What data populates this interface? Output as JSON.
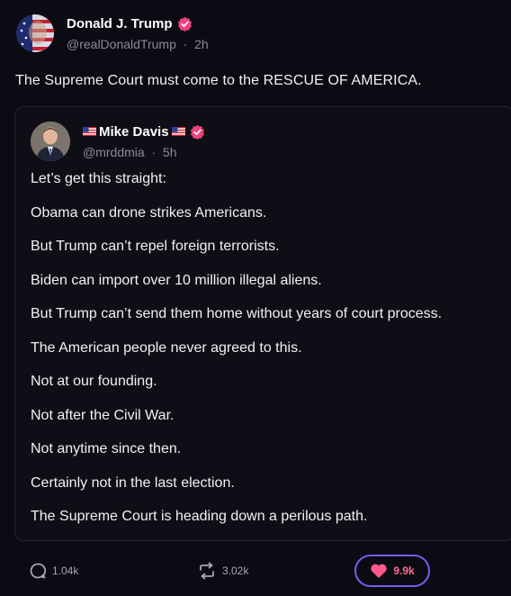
{
  "author": {
    "display_name": "Donald J. Trump",
    "handle": "@realDonaldTrump",
    "separator": "·",
    "time": "2h",
    "verified": true
  },
  "post": {
    "text": "The Supreme Court must come to the RESCUE OF AMERICA."
  },
  "quoted": {
    "author": {
      "display_name": "Mike Davis",
      "handle": "@mrddmia",
      "separator": "·",
      "time": "5h",
      "verified": true
    },
    "lines": [
      "Let’s get this straight:",
      "Obama can drone strikes Americans.",
      "But Trump can’t repel foreign terrorists.",
      "Biden can import over 10 million illegal aliens.",
      "But Trump can’t send them home without years of court process.",
      "The American people never agreed to this.",
      "Not at our founding.",
      "Not after the Civil War.",
      "Not anytime since then.",
      "Certainly not in the last election.",
      "The Supreme Court is heading down a perilous path."
    ]
  },
  "actions": {
    "replies": "1.04k",
    "reposts": "3.02k",
    "likes": "9.9k"
  },
  "colors": {
    "background": "#0c0b13",
    "verified_badge": "#f0437d",
    "like_border": "#7c5cf3",
    "like_heart": "#ff5a8a"
  }
}
